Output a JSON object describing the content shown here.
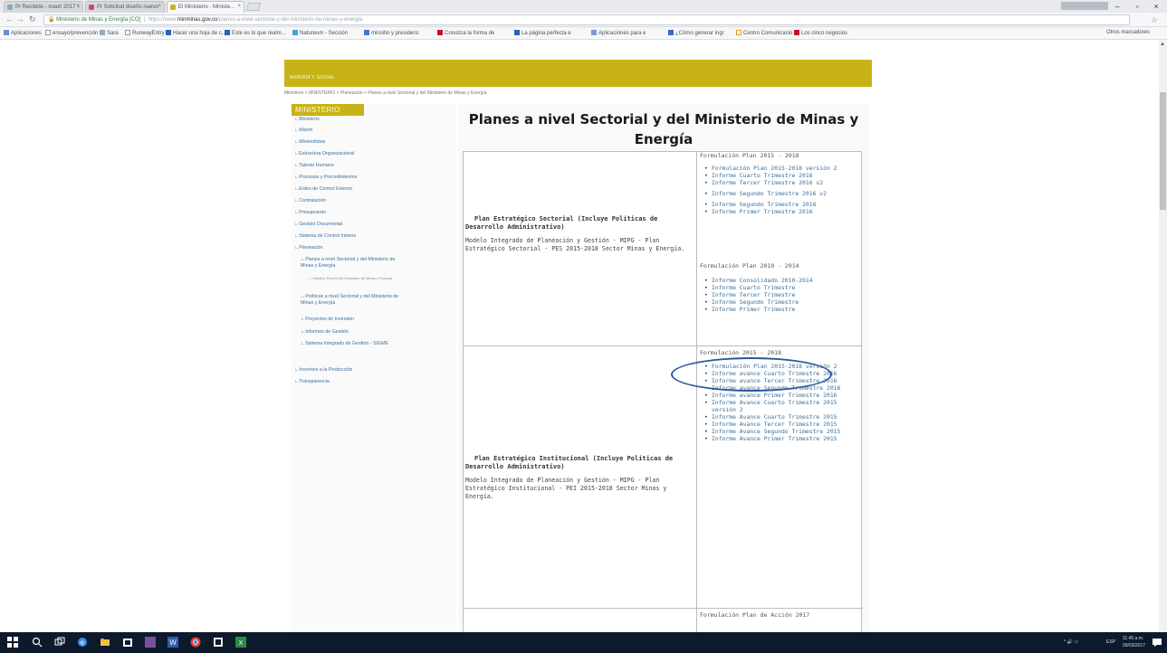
{
  "browser": {
    "tabs": [
      {
        "label": "Pr Recibido - mauri 2017 –"
      },
      {
        "label": "Pr Solicitud diseño nuevo"
      },
      {
        "label": "El Ministerio - Ministe..."
      }
    ],
    "window_user": "",
    "url_site": "Ministerio de Minas y Energía [CO]",
    "url_protocol": "https://www.",
    "url_domain": "minminas.gov.co",
    "url_path": "/planes-a-nivel-sectorial-y-del-ministerio-de-minas-y-energia",
    "bookmarks": [
      "Aplicaciones",
      "ensayo/prevención",
      "Sara",
      "RunwayEntry",
      "Hacer una hoja de c...",
      "Este es lo que realm...",
      "Natureum - Sección",
      "minsitio y presidenc",
      "Conozca la forma de",
      "La página perfecta e",
      "Aplicaciones para e",
      "¿Cómo generar ingr",
      "Centro Comunicacio",
      "Los cinco negocios",
      "Otros marcadores"
    ]
  },
  "page": {
    "banner_text": "MINERÍA Y SOCIAL",
    "breadcrumb": "Ministerio > MINISTERIO > Planeación > Planes a nivel Sectorial y del Ministerio de Minas y Energía",
    "sidebar_head": "MINISTERIO",
    "sidebar_items": [
      "Ministerio",
      "Misión",
      "Miviendistas",
      "Estructura Organizacional",
      "Talento Humano",
      "Procesos y Procedimientos",
      "Entes de Control Externo",
      "Contratación",
      "Presupuesto",
      "Gestión Documental",
      "Sistema de Control Interno",
      "Planeación",
      "Planes a nivel Sectorial y del Ministerio de Minas y Energía",
      "Histórico Planes del Ministerio de Minas y Energía",
      "Políticas a nivel Sectorial y del Ministerio de Minas y Energía",
      "Proyectos de Inversión",
      "Informes de Gestión",
      "Sistema Integrado de Gestión - SIGME",
      "Incentivo a la Producción",
      "Transparencia"
    ],
    "title": "Planes a nivel Sectorial y del Ministerio de Minas y Energía",
    "plans": [
      {
        "title": "Plan Estratégico Sectorial (Incluye Políticas de Desarrollo Administrativo)",
        "desc": "Modelo Integrado de Planeación y Gestión - MIPG - Plan Estratégico Sectorial - PES 2015-2018 Sector Minas y Energía.",
        "sections": [
          {
            "head": "Formulación Plan 2015 - 2018",
            "links": [
              "Formulación Plan 2015-2018 versión 2",
              "Informe Cuarto Trimestre 2016",
              "Informe Tercer Trimestre 2016 v2",
              "Informe Segundo Trimestre 2016 v2",
              "Informe Segundo Trimestre 2016",
              "Informe Primer Trimestre 2016"
            ]
          },
          {
            "head": "Formulación Plan 2010 - 2014",
            "links": [
              "Informe Consolidado 2010-2014",
              "Informe Cuarto Trimestre",
              "Informe Tercer Trimestre",
              "Informe Segundo Trimestre",
              "Informe Primer Trimestre"
            ]
          }
        ]
      },
      {
        "title": "Plan Estratégico Institucional (Incluye Políticas de Desarrollo Administrativo)",
        "desc": "Modelo Integrado de Planeación y Gestión - MIPG - Plan Estratégico Institucional - PEI 2015-2018 Sector Minas y Energía.",
        "sections": [
          {
            "head": "Formulación 2015 - 2018",
            "links": [
              "Formulación Plan 2015-2018 versión 2",
              "Informe avance Cuarto Trimestre 2016",
              "Informe avance Tercer Trimestre 2016",
              "Informe avance Segundo Trimestre 2016",
              "Informe avance Primer Trimestre 2016",
              "Informe Avance Cuarto Trimestre 2015 versión 2",
              "Informe Avance Cuarto Trimestre 2015",
              "Informe Avance Tercer Trimestre 2015",
              "Informe Avance Segundo Trimestre 2015",
              "Informe Avance Primer Trimestre 2015"
            ]
          }
        ]
      }
    ],
    "third_section_head": "Formulación Plan de Acción 2017"
  },
  "taskbar": {
    "time": "11:45 a.m.",
    "date": "09/03/2017",
    "lang": "ESP"
  }
}
